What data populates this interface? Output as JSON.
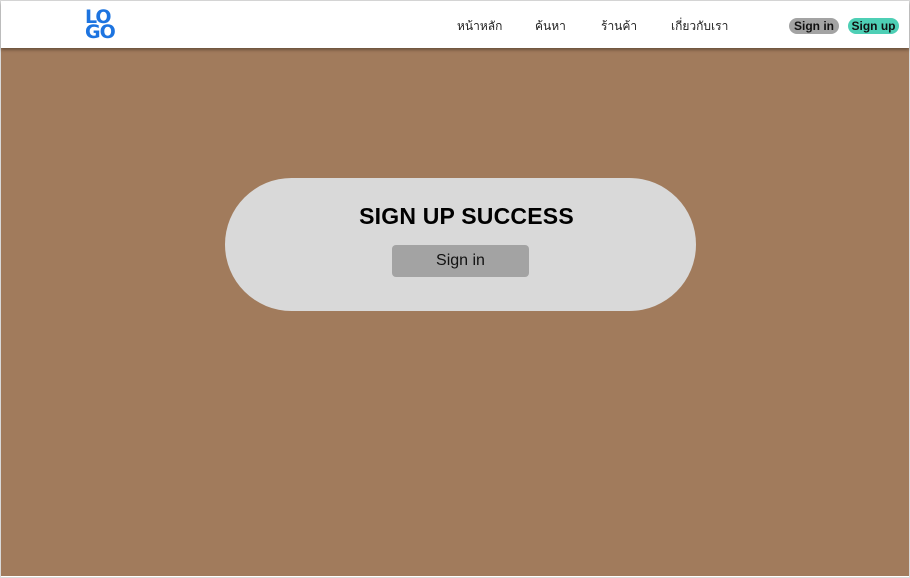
{
  "logo": {
    "line1": "LO",
    "line2": "GO",
    "color": "#1d74e0"
  },
  "nav": {
    "links": [
      "หน้าหลัก",
      "ค้นหา",
      "ร้านค้า",
      "เกี่ยวกับเรา"
    ],
    "signin_label": "Sign in",
    "signup_label": "Sign up"
  },
  "card": {
    "title": "SIGN UP SUCCESS",
    "button_label": "Sign in"
  },
  "colors": {
    "background": "#a17b5c",
    "card": "#d9d9d9",
    "button_gray": "#a3a3a3",
    "signup_accent": "#4ecfb5"
  }
}
